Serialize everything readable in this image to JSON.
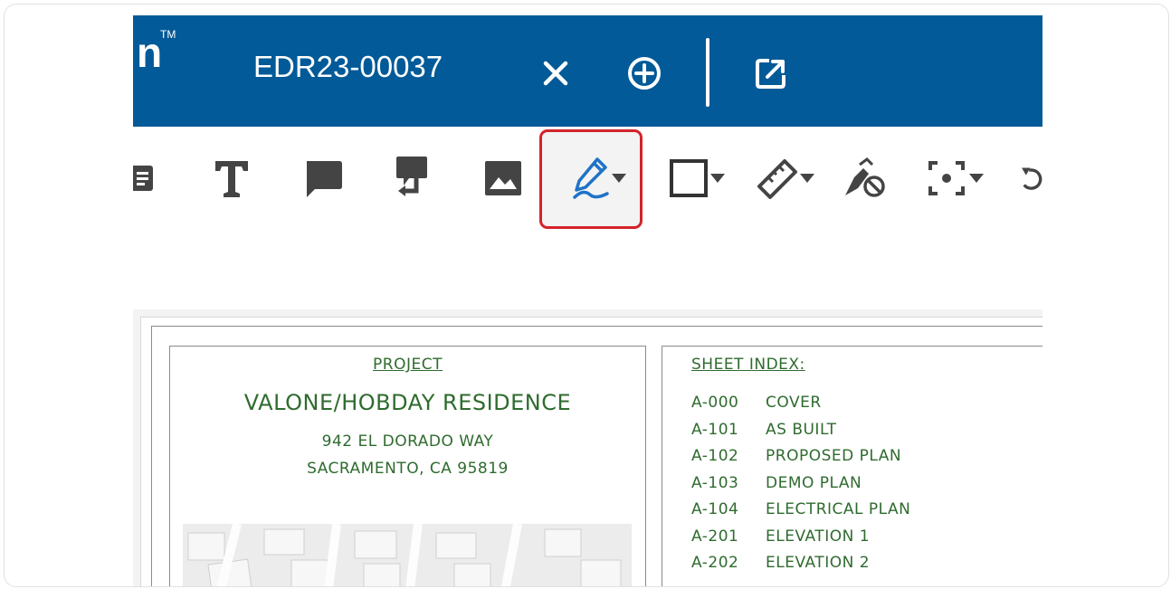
{
  "header": {
    "logo_text": "n",
    "logo_tm": "TM",
    "document_tab": "EDR23-00037",
    "close_icon": "close-icon",
    "add_icon": "add-circle-icon",
    "popout_icon": "external-link-icon"
  },
  "toolbar": {
    "tools": [
      "note-icon",
      "text-icon",
      "comment-icon",
      "callout-icon",
      "image-icon",
      "pen-icon",
      "rectangle-icon",
      "ruler-icon",
      "eraser-icon",
      "capture-icon",
      "undo-icon"
    ],
    "active_tool": "pen-icon",
    "highlight_color": "#d3232a"
  },
  "colors": {
    "header_bg": "#035a98",
    "drawing_ink": "#2f6b2f"
  },
  "document": {
    "project_label": "PROJECT",
    "project_name": "VALONE/HOBDAY RESIDENCE",
    "address_line1": "942 EL DORADO WAY",
    "address_line2": "SACRAMENTO, CA 95819",
    "sheet_index_title": "SHEET INDEX:",
    "sheets": [
      {
        "code": "A-000",
        "name": "COVER"
      },
      {
        "code": "A-101",
        "name": "AS BUILT"
      },
      {
        "code": "A-102",
        "name": "PROPOSED PLAN"
      },
      {
        "code": "A-103",
        "name": "DEMO PLAN"
      },
      {
        "code": "A-104",
        "name": "ELECTRICAL PLAN"
      },
      {
        "code": "A-201",
        "name": "ELEVATION 1"
      },
      {
        "code": "A-202",
        "name": "ELEVATION 2"
      }
    ]
  }
}
